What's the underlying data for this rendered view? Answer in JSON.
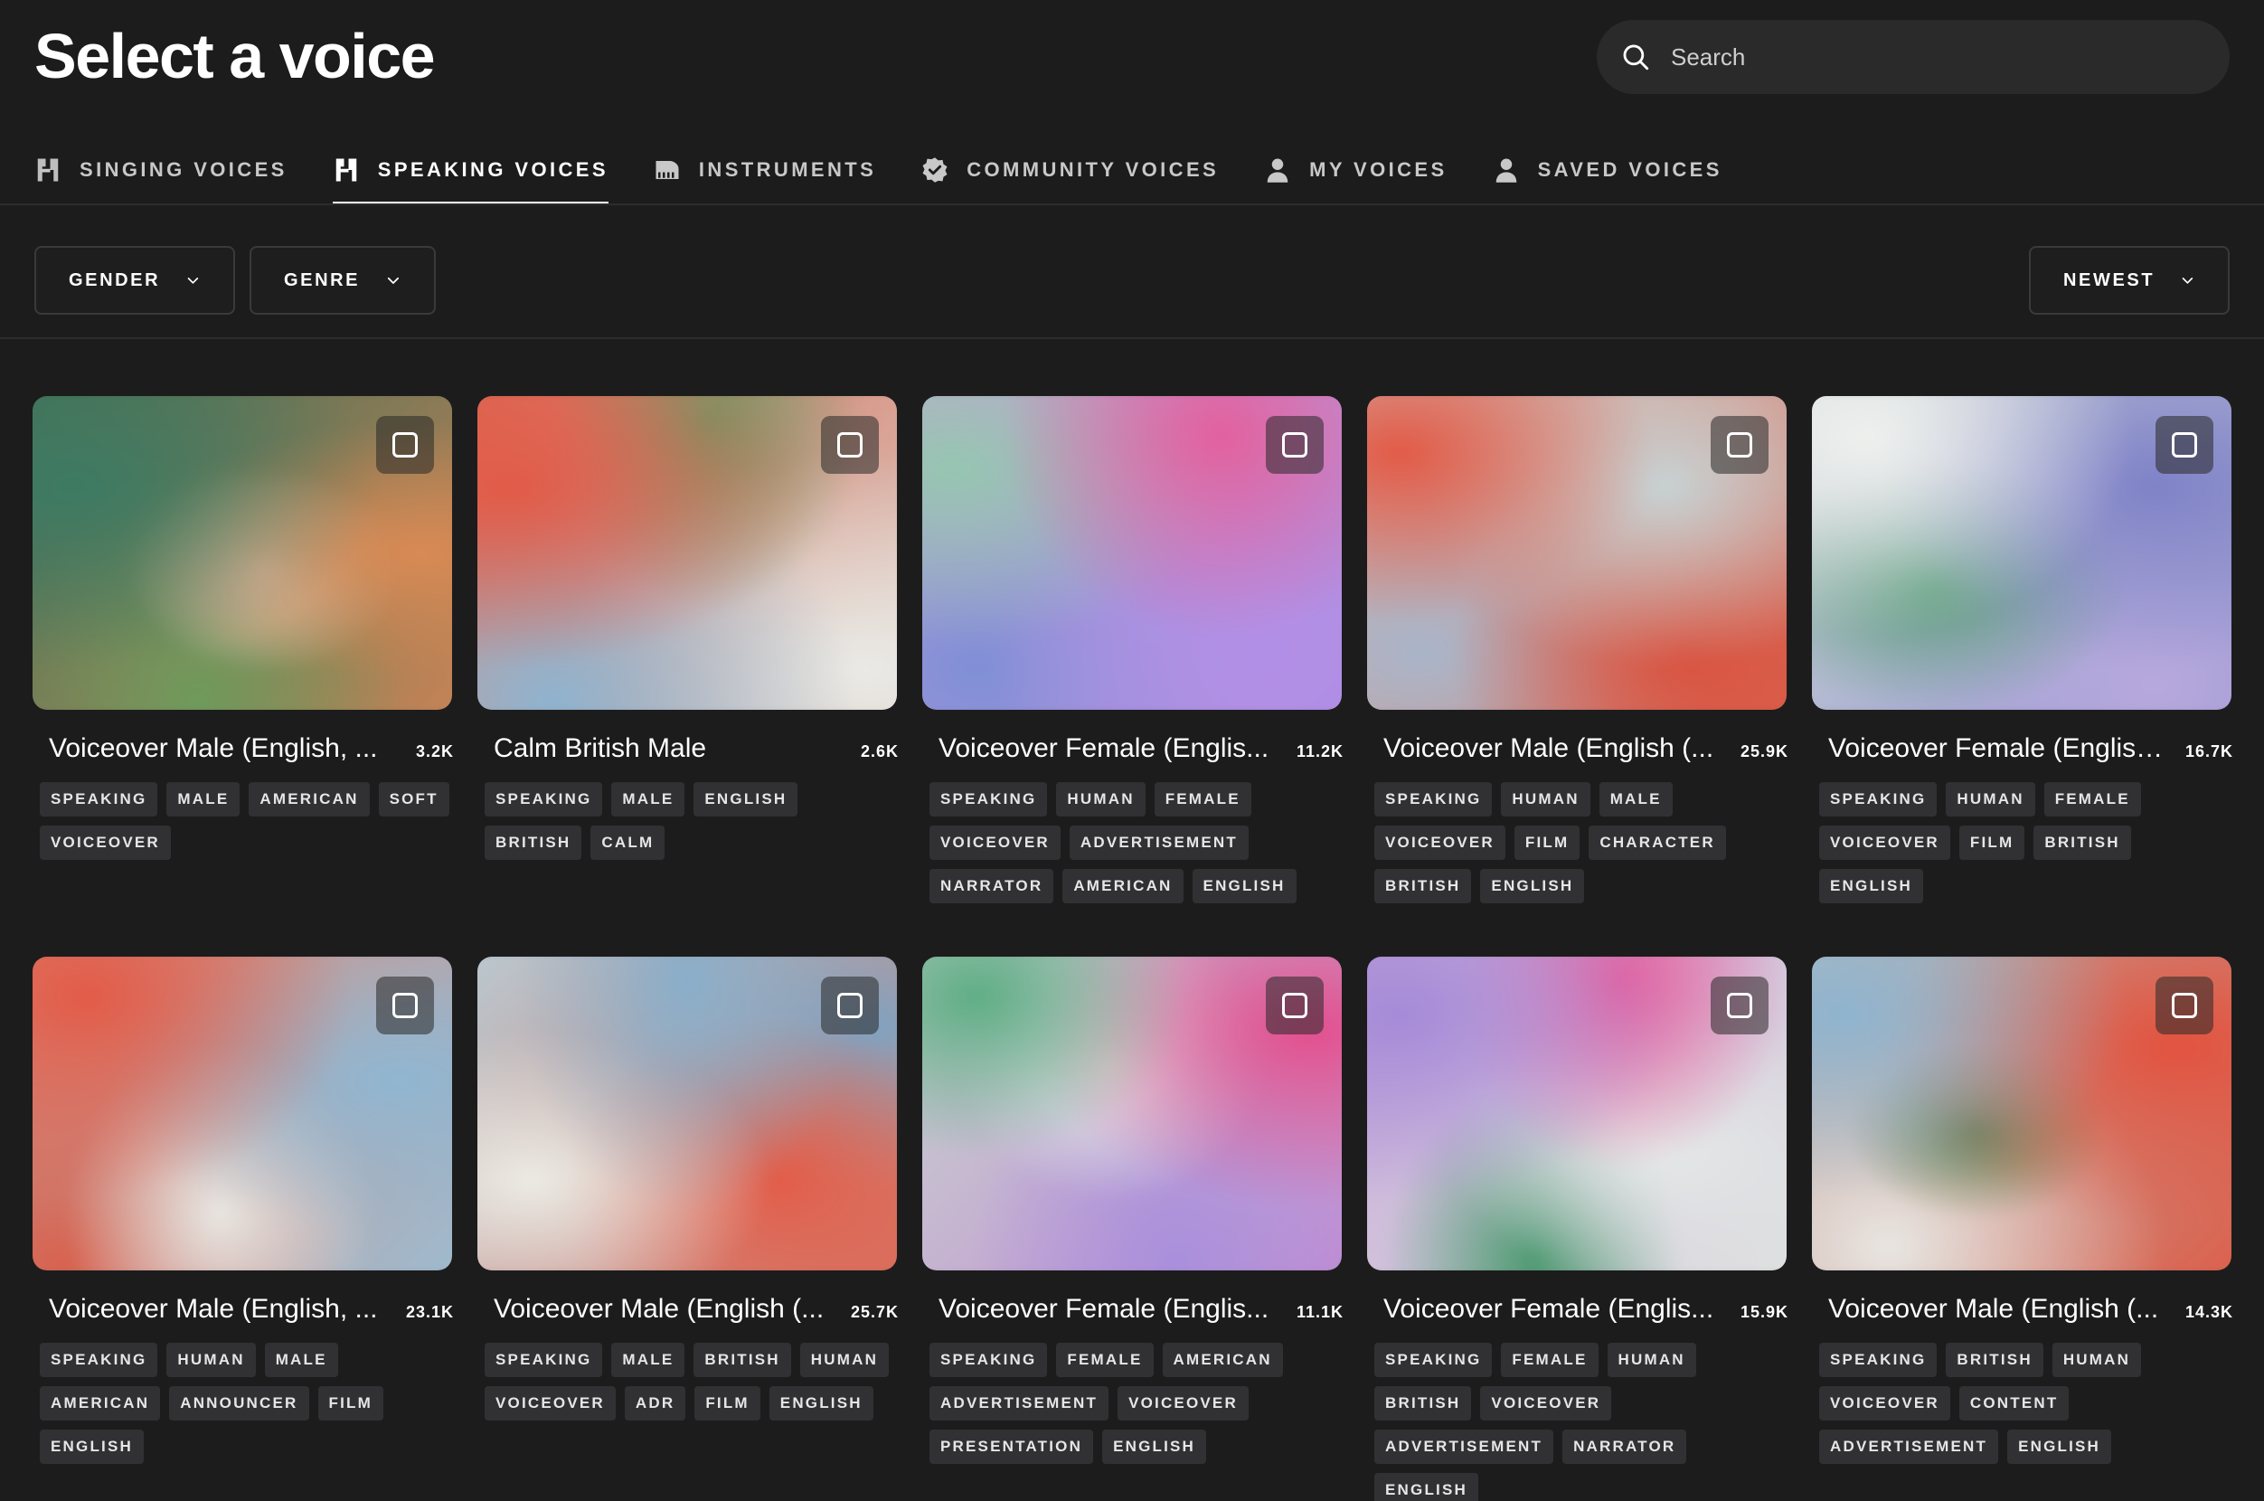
{
  "header": {
    "title": "Select a voice",
    "search_placeholder": "Search"
  },
  "tabs": [
    {
      "label": "SINGING VOICES",
      "icon": "singing-voices-icon"
    },
    {
      "label": "SPEAKING VOICES",
      "icon": "speaking-voices-icon",
      "active": true
    },
    {
      "label": "INSTRUMENTS",
      "icon": "piano-icon"
    },
    {
      "label": "COMMUNITY VOICES",
      "icon": "verified-badge-icon"
    },
    {
      "label": "MY VOICES",
      "icon": "user-icon"
    },
    {
      "label": "SAVED VOICES",
      "icon": "user-icon"
    }
  ],
  "filters": {
    "gender": "GENDER",
    "genre": "GENRE",
    "sort": "NEWEST"
  },
  "colors": {
    "background": "#1c1c1d",
    "tag_background": "#313133",
    "search_background": "#2a2a2b"
  },
  "voices": [
    {
      "title": "Voiceover Male (English, ...",
      "count": "3.2K",
      "tags": [
        "SPEAKING",
        "MALE",
        "AMERICAN",
        "SOFT",
        "VOICEOVER"
      ]
    },
    {
      "title": "Calm British Male",
      "count": "2.6K",
      "tags": [
        "SPEAKING",
        "MALE",
        "ENGLISH",
        "BRITISH",
        "CALM"
      ]
    },
    {
      "title": "Voiceover Female (Englis...",
      "count": "11.2K",
      "tags": [
        "SPEAKING",
        "HUMAN",
        "FEMALE",
        "VOICEOVER",
        "ADVERTISEMENT",
        "NARRATOR",
        "AMERICAN",
        "ENGLISH"
      ]
    },
    {
      "title": "Voiceover Male (English (...",
      "count": "25.9K",
      "tags": [
        "SPEAKING",
        "HUMAN",
        "MALE",
        "VOICEOVER",
        "FILM",
        "CHARACTER",
        "BRITISH",
        "ENGLISH"
      ]
    },
    {
      "title": "Voiceover Female (English...",
      "count": "16.7K",
      "tags": [
        "SPEAKING",
        "HUMAN",
        "FEMALE",
        "VOICEOVER",
        "FILM",
        "BRITISH",
        "ENGLISH"
      ]
    },
    {
      "title": "Voiceover Male (English, ...",
      "count": "23.1K",
      "tags": [
        "SPEAKING",
        "HUMAN",
        "MALE",
        "AMERICAN",
        "ANNOUNCER",
        "FILM",
        "ENGLISH"
      ]
    },
    {
      "title": "Voiceover Male (English (...",
      "count": "25.7K",
      "tags": [
        "SPEAKING",
        "MALE",
        "BRITISH",
        "HUMAN",
        "VOICEOVER",
        "ADR",
        "FILM",
        "ENGLISH"
      ]
    },
    {
      "title": "Voiceover Female (Englis...",
      "count": "11.1K",
      "tags": [
        "SPEAKING",
        "FEMALE",
        "AMERICAN",
        "ADVERTISEMENT",
        "VOICEOVER",
        "PRESENTATION",
        "ENGLISH"
      ]
    },
    {
      "title": "Voiceover Female (Englis...",
      "count": "15.9K",
      "tags": [
        "SPEAKING",
        "FEMALE",
        "HUMAN",
        "BRITISH",
        "VOICEOVER",
        "ADVERTISEMENT",
        "NARRATOR",
        "ENGLISH"
      ]
    },
    {
      "title": "Voiceover Male (English (...",
      "count": "14.3K",
      "tags": [
        "SPEAKING",
        "BRITISH",
        "HUMAN",
        "VOICEOVER",
        "CONTENT",
        "ADVERTISEMENT",
        "ENGLISH"
      ]
    }
  ]
}
